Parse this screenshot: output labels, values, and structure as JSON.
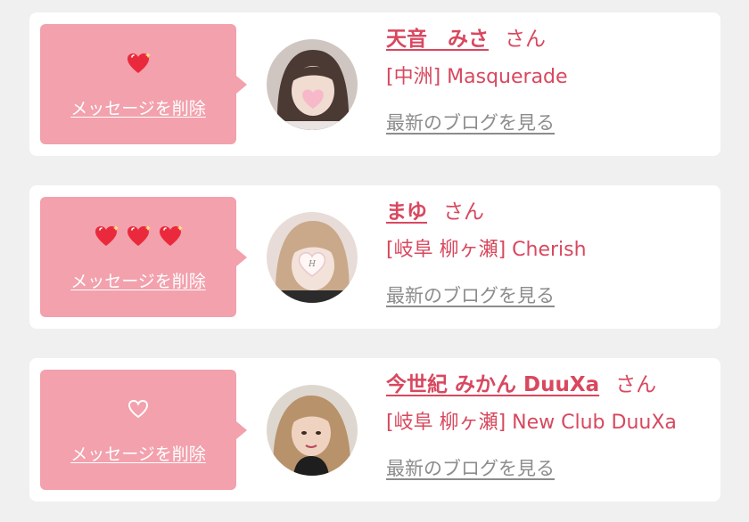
{
  "colors": {
    "accent": "#d8485f",
    "bubble": "#f2a1ad",
    "heart": "#ea2a3c",
    "link_gray": "#8c8c8c",
    "background": "#f0f0f0"
  },
  "messages": [
    {
      "name": "天音　みさ",
      "honorific": "さん",
      "shop": "[中洲] Masquerade",
      "blog_link": "最新のブログを見る",
      "delete_label": "メッセージを削除",
      "hearts": [
        "sparkle-heart-icon"
      ],
      "avatar": "avatar-photo-1"
    },
    {
      "name": "まゆ",
      "honorific": "さん",
      "shop": "[岐阜 柳ヶ瀬] Cherish",
      "blog_link": "最新のブログを見る",
      "delete_label": "メッセージを削除",
      "hearts": [
        "sparkle-heart-icon",
        "sparkle-heart-icon",
        "sparkle-heart-icon"
      ],
      "avatar": "avatar-photo-2"
    },
    {
      "name": "今世紀 みかん DuuXa",
      "honorific": "さん",
      "shop": "[岐阜 柳ヶ瀬] New Club DuuXa",
      "blog_link": "最新のブログを見る",
      "delete_label": "メッセージを削除",
      "hearts": [
        "outline-heart-icon"
      ],
      "avatar": "avatar-photo-3"
    }
  ]
}
